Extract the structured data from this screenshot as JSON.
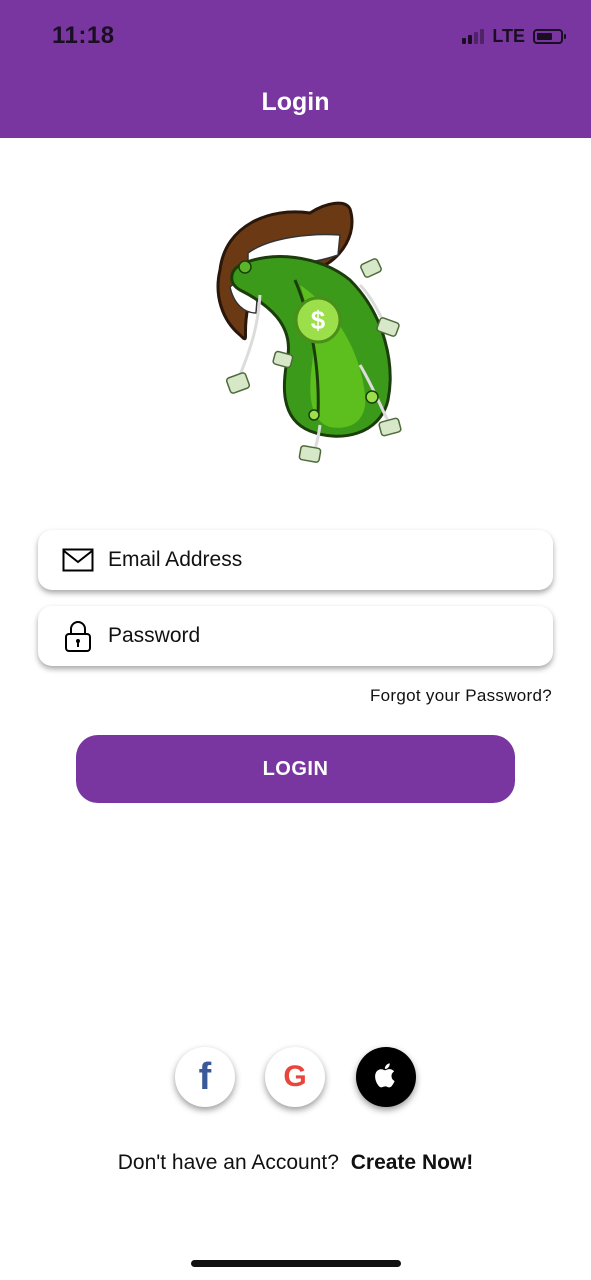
{
  "status_bar": {
    "time": "11:18",
    "network": "LTE",
    "battery_level": 0.6
  },
  "header": {
    "title": "Login"
  },
  "form": {
    "email_placeholder": "Email Address",
    "password_placeholder": "Password",
    "forgot_label": "Forgot your Password?",
    "login_label": "LOGIN"
  },
  "social": {
    "facebook_letter": "f",
    "google_letter": "G"
  },
  "footer": {
    "prompt": "Don't have an Account?",
    "create_label": "Create Now!"
  },
  "colors": {
    "brand": "#7a36a0",
    "facebook": "#3b5998",
    "google": "#e8453c"
  },
  "icons": {
    "email": "envelope-icon",
    "password": "lock-icon",
    "facebook": "facebook-icon",
    "google": "google-icon",
    "apple": "apple-icon"
  }
}
